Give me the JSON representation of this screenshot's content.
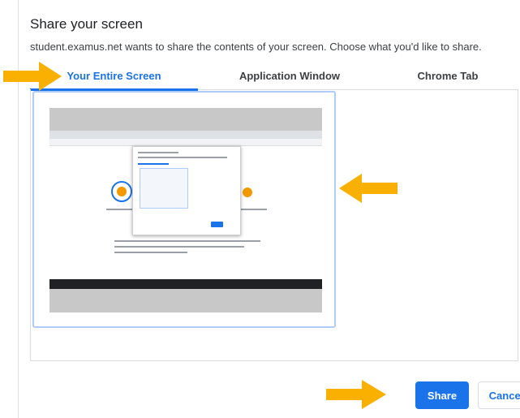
{
  "dialog": {
    "title": "Share your screen",
    "subtitle": "student.examus.net wants to share the contents of your screen. Choose what you'd like to share."
  },
  "tabs": [
    {
      "label": "Your Entire Screen",
      "active": true
    },
    {
      "label": "Application Window",
      "active": false
    },
    {
      "label": "Chrome Tab",
      "active": false
    }
  ],
  "buttons": {
    "share_label": "Share",
    "cancel_label": "Cancel"
  },
  "annotations": {
    "arrow_color": "#f9b000",
    "arrow_icon": "arrow-icon"
  },
  "colors": {
    "accent": "#1a73e8",
    "thumbnail_border": "#aecbfa"
  }
}
